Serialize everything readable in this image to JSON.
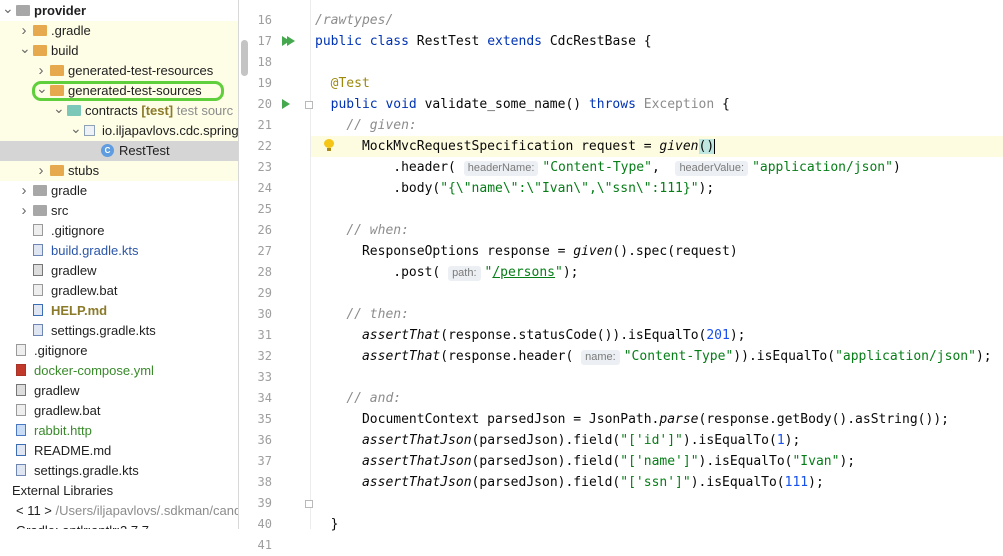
{
  "tree": [
    {
      "text": "provider",
      "indent": 0,
      "arrow": "v",
      "icon": "folder",
      "cls": "c-bold",
      "hl": false
    },
    {
      "text": ".gradle",
      "indent": 1,
      "arrow": ">",
      "icon": "folder-orange",
      "cls": "",
      "hl": true
    },
    {
      "text": "build",
      "indent": 1,
      "arrow": "v",
      "icon": "folder-orange",
      "cls": "",
      "hl": true
    },
    {
      "text": "generated-test-resources",
      "indent": 2,
      "arrow": ">",
      "icon": "folder-orange",
      "cls": "",
      "hl": true
    },
    {
      "text": "generated-test-sources",
      "indent": 2,
      "arrow": "v",
      "icon": "folder-orange",
      "cls": "",
      "hl": true
    },
    {
      "text": "contracts",
      "suffix": "[test]",
      "extra": "test sourc",
      "indent": 3,
      "arrow": "v",
      "icon": "folder-teal",
      "cls": "",
      "hl": true
    },
    {
      "text": "io.iljapavlovs.cdc.spring",
      "indent": 4,
      "arrow": "v",
      "icon": "package",
      "cls": "",
      "hl": true
    },
    {
      "text": "RestTest",
      "indent": 5,
      "arrow": "",
      "icon": "class",
      "cls": "",
      "hl": false,
      "sel": true
    },
    {
      "text": "stubs",
      "indent": 2,
      "arrow": ">",
      "icon": "folder-orange",
      "cls": "",
      "hl": true
    },
    {
      "text": "gradle",
      "indent": 1,
      "arrow": ">",
      "icon": "folder",
      "cls": "",
      "hl": false
    },
    {
      "text": "src",
      "indent": 1,
      "arrow": ">",
      "icon": "folder",
      "cls": "",
      "hl": false
    },
    {
      "text": ".gitignore",
      "indent": 1,
      "arrow": "",
      "icon": "file",
      "cls": "",
      "hl": false
    },
    {
      "text": "build.gradle.kts",
      "indent": 1,
      "arrow": "",
      "icon": "file-kts",
      "cls": "c-blue",
      "hl": false
    },
    {
      "text": "gradlew",
      "indent": 1,
      "arrow": "",
      "icon": "file-exe",
      "cls": "",
      "hl": false
    },
    {
      "text": "gradlew.bat",
      "indent": 1,
      "arrow": "",
      "icon": "file",
      "cls": "",
      "hl": false
    },
    {
      "text": "HELP.md",
      "indent": 1,
      "arrow": "",
      "icon": "file-md",
      "cls": "c-yellowmark",
      "hl": false
    },
    {
      "text": "settings.gradle.kts",
      "indent": 1,
      "arrow": "",
      "icon": "file-kts",
      "cls": "",
      "hl": false
    },
    {
      "text": ".gitignore",
      "indent": 0,
      "arrow": "",
      "icon": "file",
      "cls": "",
      "hl": false
    },
    {
      "text": "docker-compose.yml",
      "indent": 0,
      "arrow": "",
      "icon": "file-yml",
      "cls": "c-green",
      "hl": false
    },
    {
      "text": "gradlew",
      "indent": 0,
      "arrow": "",
      "icon": "file-exe",
      "cls": "",
      "hl": false
    },
    {
      "text": "gradlew.bat",
      "indent": 0,
      "arrow": "",
      "icon": "file",
      "cls": "",
      "hl": false
    },
    {
      "text": "rabbit.http",
      "indent": 0,
      "arrow": "",
      "icon": "file-http",
      "cls": "c-green",
      "hl": false
    },
    {
      "text": "README.md",
      "indent": 0,
      "arrow": "",
      "icon": "file-md",
      "cls": "",
      "hl": false
    },
    {
      "text": "settings.gradle.kts",
      "indent": 0,
      "arrow": "",
      "icon": "file-kts",
      "cls": "",
      "hl": false
    },
    {
      "text": "External Libraries",
      "indent": -1,
      "arrow": "",
      "icon": "none",
      "cls": "",
      "hl": false
    },
    {
      "text": "< 11 >",
      "extra": "/Users/iljapavlovs/.sdkman/cand",
      "indent": 0,
      "arrow": "",
      "icon": "none",
      "cls": "",
      "hl": false
    },
    {
      "text": "Gradle: antlr:antlr:2.7.7",
      "indent": 0,
      "arrow": "",
      "icon": "none",
      "cls": "",
      "hl": false
    }
  ],
  "editor": {
    "line_start": 16,
    "lines": [
      [
        [
          "cm",
          "/rawtypes/"
        ]
      ],
      [
        [
          "kw",
          "public class "
        ],
        [
          "",
          "RestTest "
        ],
        [
          "kw",
          "extends "
        ],
        [
          "",
          "CdcRestBase {"
        ]
      ],
      [
        [
          "",
          ""
        ]
      ],
      [
        [
          "",
          "  "
        ],
        [
          "ann",
          "@Test"
        ]
      ],
      [
        [
          "",
          "  "
        ],
        [
          "kw",
          "public void "
        ],
        [
          "",
          "validate_some_name() "
        ],
        [
          "kw",
          "throws "
        ],
        [
          "gr",
          "Exception"
        ],
        [
          "",
          " {"
        ]
      ],
      [
        [
          "",
          "    "
        ],
        [
          "cm",
          "// given:"
        ]
      ],
      [
        [
          "",
          "      MockMvcRequestSpecification request = "
        ],
        [
          "it",
          "given"
        ],
        [
          "brk",
          "()"
        ],
        [
          "cursor",
          ""
        ]
      ],
      [
        [
          "",
          "          .header( "
        ],
        [
          "hint",
          "headerName:"
        ],
        [
          "str",
          "\"Content-Type\""
        ],
        [
          "",
          ",  "
        ],
        [
          "hint",
          "headerValue:"
        ],
        [
          "str",
          "\"application/json\""
        ],
        [
          "",
          ")"
        ]
      ],
      [
        [
          "",
          "          .body("
        ],
        [
          "str",
          "\"{\\\"name\\\":\\\"Ivan\\\",\\\"ssn\\\":111}\""
        ],
        [
          "",
          ");"
        ]
      ],
      [
        [
          "",
          ""
        ]
      ],
      [
        [
          "",
          "    "
        ],
        [
          "cm",
          "// when:"
        ]
      ],
      [
        [
          "",
          "      ResponseOptions response = "
        ],
        [
          "it",
          "given"
        ],
        [
          "",
          "().spec(request)"
        ]
      ],
      [
        [
          "",
          "          .post( "
        ],
        [
          "hint",
          "path:"
        ],
        [
          "str",
          "\""
        ],
        [
          "str und",
          "/persons"
        ],
        [
          "str",
          "\""
        ],
        [
          "",
          ");"
        ]
      ],
      [
        [
          "",
          ""
        ]
      ],
      [
        [
          "",
          "    "
        ],
        [
          "cm",
          "// then:"
        ]
      ],
      [
        [
          "",
          "      "
        ],
        [
          "it",
          "assertThat"
        ],
        [
          "",
          "(response.statusCode()).isEqualTo("
        ],
        [
          "num",
          "201"
        ],
        [
          "",
          ");"
        ]
      ],
      [
        [
          "",
          "      "
        ],
        [
          "it",
          "assertThat"
        ],
        [
          "",
          "(response.header( "
        ],
        [
          "hint",
          "name:"
        ],
        [
          "str",
          "\"Content-Type\""
        ],
        [
          "",
          "))."
        ],
        [
          "",
          "isEqualTo("
        ],
        [
          "str",
          "\"application/json\""
        ],
        [
          "",
          ");"
        ]
      ],
      [
        [
          "",
          ""
        ]
      ],
      [
        [
          "",
          "    "
        ],
        [
          "cm",
          "// and:"
        ]
      ],
      [
        [
          "",
          "      DocumentContext parsedJson = JsonPath."
        ],
        [
          "it",
          "parse"
        ],
        [
          "",
          "(response.getBody().asString());"
        ]
      ],
      [
        [
          "",
          "      "
        ],
        [
          "it",
          "assertThatJson"
        ],
        [
          "",
          "(parsedJson).field("
        ],
        [
          "str",
          "\"['id']\""
        ],
        [
          "",
          ").isEqualTo("
        ],
        [
          "num",
          "1"
        ],
        [
          "",
          ");"
        ]
      ],
      [
        [
          "",
          "      "
        ],
        [
          "it",
          "assertThatJson"
        ],
        [
          "",
          "(parsedJson).field("
        ],
        [
          "str",
          "\"['name']\""
        ],
        [
          "",
          ").isEqualTo("
        ],
        [
          "str",
          "\"Ivan\""
        ],
        [
          "",
          ");"
        ]
      ],
      [
        [
          "",
          "      "
        ],
        [
          "it",
          "assertThatJson"
        ],
        [
          "",
          "(parsedJson).field("
        ],
        [
          "str",
          "\"['ssn']\""
        ],
        [
          "",
          ").isEqualTo("
        ],
        [
          "num",
          "111"
        ],
        [
          "",
          ");"
        ]
      ],
      [
        [
          "",
          ""
        ]
      ],
      [
        [
          "",
          "  }"
        ]
      ],
      [
        [
          "",
          ""
        ]
      ]
    ]
  }
}
